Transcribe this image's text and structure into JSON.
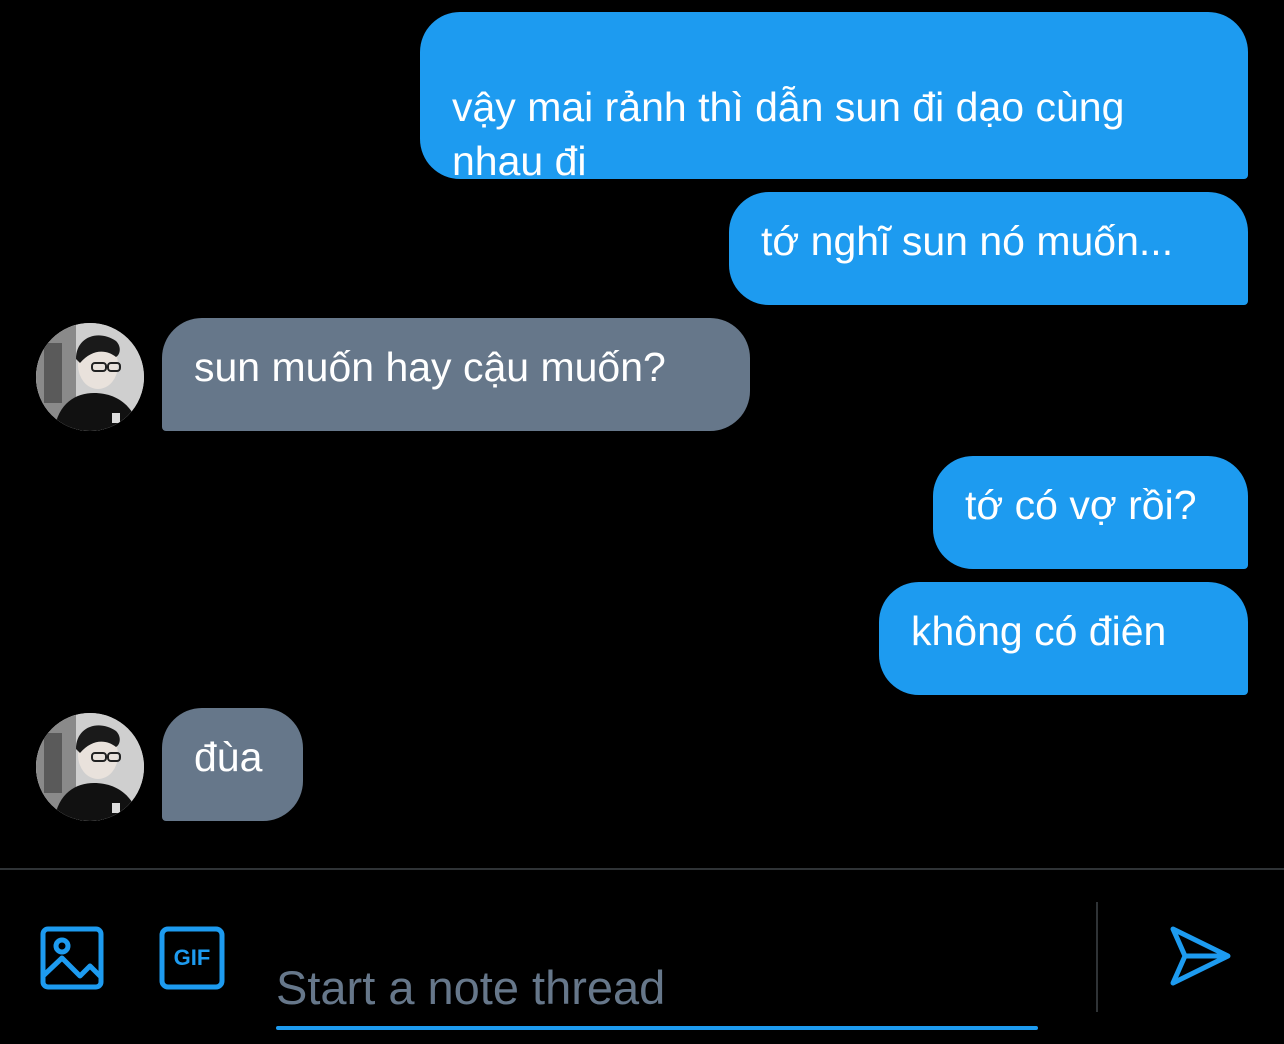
{
  "messages": [
    {
      "direction": "outgoing",
      "text": "vậy mai rảnh thì dẫn sun đi dạo cùng\nnhau đi"
    },
    {
      "direction": "outgoing",
      "text": "tớ nghĩ sun nó muốn..."
    },
    {
      "direction": "incoming",
      "text": "sun muốn hay cậu muốn?"
    },
    {
      "direction": "outgoing",
      "text": "tớ có vợ rồi?"
    },
    {
      "direction": "outgoing",
      "text": "không có điên"
    },
    {
      "direction": "incoming",
      "text": "đùa"
    }
  ],
  "composer": {
    "placeholder": "Start a note thread",
    "gif_label": "GIF"
  },
  "icons": {
    "media": "image-icon",
    "gif": "gif-icon",
    "send": "send-icon"
  },
  "colors": {
    "background": "#000000",
    "outgoing_bubble": "#1d9bf0",
    "incoming_bubble": "#66778a",
    "accent": "#1d9bf0",
    "placeholder": "#66778a"
  }
}
